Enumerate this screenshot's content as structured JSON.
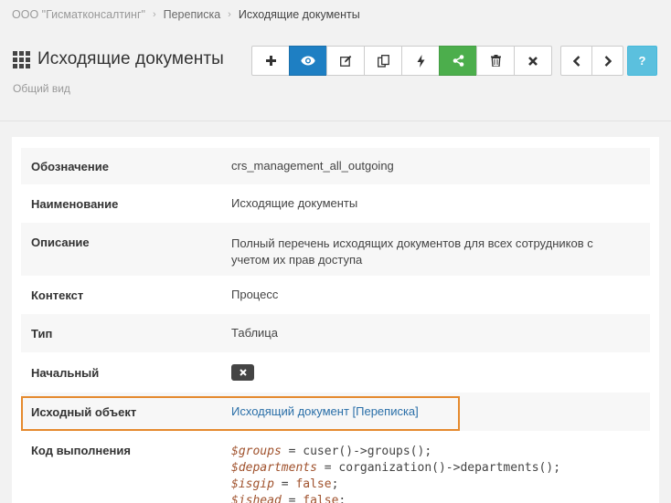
{
  "breadcrumb": {
    "org": "ООО \"Гисматконсалтинг\"",
    "section": "Переписка",
    "current": "Исходящие документы"
  },
  "header": {
    "title": "Исходящие документы",
    "subtitle": "Общий вид"
  },
  "toolbar": {
    "help_label": "?"
  },
  "fields": {
    "designation": {
      "label": "Обозначение",
      "value": "crs_management_all_outgoing"
    },
    "name": {
      "label": "Наименование",
      "value": "Исходящие документы"
    },
    "description": {
      "label": "Описание",
      "value_line1": "Полный перечень исходящих документов для всех сотрудников с",
      "value_line2": "учетом их прав доступа"
    },
    "context": {
      "label": "Контекст",
      "value": "Процесс"
    },
    "type": {
      "label": "Тип",
      "value": "Таблица"
    },
    "initial": {
      "label": "Начальный"
    },
    "source_object": {
      "label": "Исходный объект",
      "value": "Исходящий документ [Переписка]"
    },
    "exec_code": {
      "label": "Код выполнения",
      "line1_var": "$groups",
      "line1_rest": " = cuser()->groups();",
      "line2_var": "$departments",
      "line2_rest": " = corganization()->departments();",
      "line3_var": "$isgip",
      "line3_mid": " = ",
      "line3_kw": "false",
      "line3_end": ";",
      "line4_var": "$ishead",
      "line4_mid": " = ",
      "line4_kw": "false",
      "line4_end": ";"
    }
  },
  "colors": {
    "primary": "#1e7fc3",
    "success": "#4cae4c",
    "info": "#5bc0de",
    "highlight": "#e58a2e"
  }
}
